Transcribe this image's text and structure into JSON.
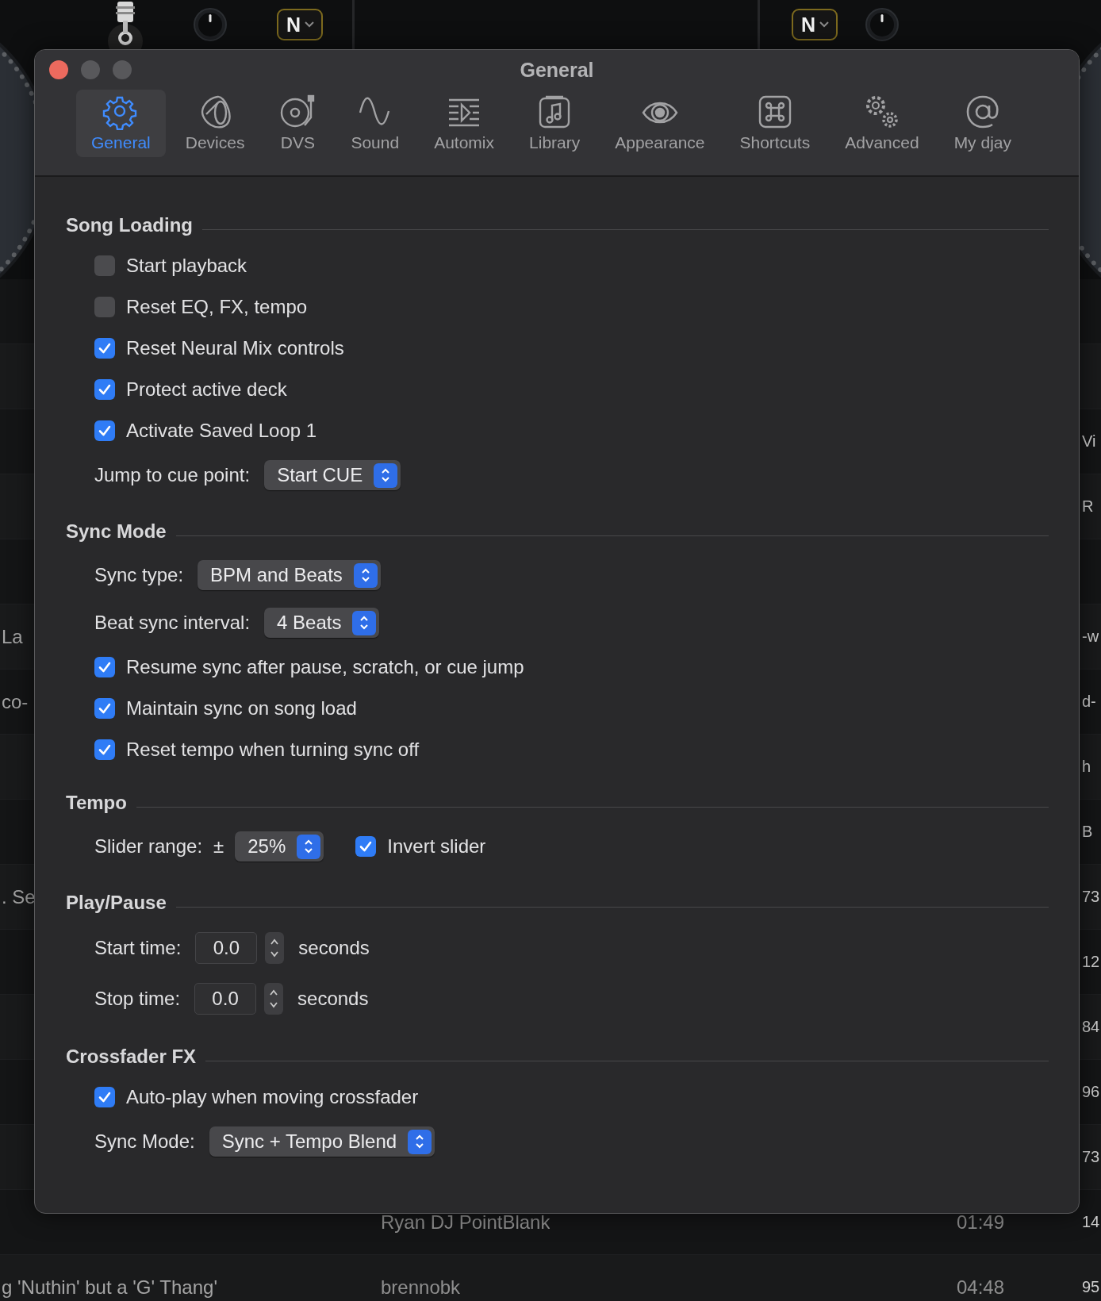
{
  "decks": [
    {
      "badge": "N"
    },
    {
      "badge": "N"
    }
  ],
  "background_rows": [
    {},
    {},
    {
      "column_4": "Vi"
    },
    {
      "column_4": "R"
    },
    {},
    {
      "column_1": "La",
      "column_4": "-w"
    },
    {
      "column_1": "co-",
      "column_4": "d-"
    },
    {
      "column_4": "h"
    },
    {
      "column_4": "B"
    },
    {
      "column_1": ". Se",
      "column_4": "73"
    },
    {
      "column_4": "12"
    },
    {
      "column_4": "84"
    },
    {
      "column_4": "96"
    },
    {
      "column_4": "73"
    },
    {
      "column_2": "Ryan DJ PointBlank",
      "column_3": "01:49",
      "column_4": "14"
    },
    {
      "column_1": "g 'Nuthin' but a 'G' Thang'",
      "column_2": "brennobk",
      "column_3": "04:48",
      "column_4": "95"
    }
  ],
  "window": {
    "title": "General"
  },
  "toolbar": [
    {
      "kind": "gear",
      "label": "General",
      "selected": true
    },
    {
      "kind": "speaker",
      "label": "Devices",
      "selected": false
    },
    {
      "kind": "turntable",
      "label": "DVS",
      "selected": false
    },
    {
      "kind": "wave",
      "label": "Sound",
      "selected": false
    },
    {
      "kind": "automix",
      "label": "Automix",
      "selected": false
    },
    {
      "kind": "note",
      "label": "Library",
      "selected": false
    },
    {
      "kind": "eye",
      "label": "Appearance",
      "selected": false
    },
    {
      "kind": "command",
      "label": "Shortcuts",
      "selected": false
    },
    {
      "kind": "gears",
      "label": "Advanced",
      "selected": false
    },
    {
      "kind": "at",
      "label": "My djay",
      "selected": false
    }
  ],
  "sections": [
    {
      "title": "Song Loading",
      "items": [
        {
          "kind": "checkbox",
          "label": "Start playback",
          "checked": false
        },
        {
          "kind": "checkbox",
          "label": "Reset EQ, FX, tempo",
          "checked": false
        },
        {
          "kind": "checkbox",
          "label": "Reset Neural Mix controls",
          "checked": true
        },
        {
          "kind": "checkbox",
          "label": "Protect active deck",
          "checked": true
        },
        {
          "kind": "checkbox",
          "label": "Activate Saved Loop 1",
          "checked": true
        },
        {
          "kind": "popup",
          "label": "Jump to cue point:",
          "value": "Start CUE"
        }
      ]
    },
    {
      "title": "Sync Mode",
      "items": [
        {
          "kind": "popup",
          "label": "Sync type:",
          "value": "BPM and Beats"
        },
        {
          "kind": "popup",
          "label": "Beat sync interval:",
          "value": "4 Beats"
        },
        {
          "kind": "checkbox",
          "label": "Resume sync after pause, scratch, or cue jump",
          "checked": true
        },
        {
          "kind": "checkbox",
          "label": "Maintain sync on song load",
          "checked": true
        },
        {
          "kind": "checkbox",
          "label": "Reset tempo when turning sync off",
          "checked": true
        }
      ]
    },
    {
      "title": "Tempo",
      "items": [
        {
          "kind": "range",
          "label": "Slider range:",
          "prefix": "±",
          "value": "25%",
          "option": {
            "label": "Invert slider",
            "checked": true
          }
        }
      ]
    },
    {
      "title": "Play/Pause",
      "items": [
        {
          "kind": "stepper",
          "label": "Start time:",
          "value": "0.0",
          "unit": "seconds"
        },
        {
          "kind": "stepper",
          "label": "Stop time:",
          "value": "0.0",
          "unit": "seconds"
        }
      ]
    },
    {
      "title": "Crossfader FX",
      "items": [
        {
          "kind": "checkbox",
          "label": "Auto-play when moving crossfader",
          "checked": true
        },
        {
          "kind": "popup",
          "label": "Sync Mode:",
          "value": "Sync + Tempo Blend"
        }
      ]
    }
  ]
}
